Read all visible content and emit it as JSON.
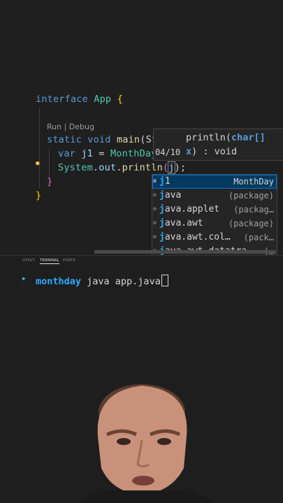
{
  "editor": {
    "code_lens": "Run | Debug",
    "lines": {
      "l1_kw": "interface",
      "l1_name": " App ",
      "l1_brace": "{",
      "l2_kw1": "static",
      "l2_kw2": "void",
      "l2_fn": "main",
      "l2_rest": "(St",
      "l3_kw": "var",
      "l3_var": "j1",
      "l3_eq": " = ",
      "l3_cls": "MonthDay",
      "l4_obj": "System",
      "l4_dot1": ".",
      "l4_out": "out",
      "l4_dot2": ".",
      "l4_fn": "println",
      "l4_open": "(",
      "l4_arg": "j",
      "l4_close": ");",
      "l5_brace": "}",
      "l6_brace": "}"
    }
  },
  "signature_hint": {
    "date_fragment": "04/10",
    "line1_prefix": "println(",
    "line1_param": "char[]",
    "line2_param": "x",
    "line2_suffix": ") : void"
  },
  "suggestions": [
    {
      "match": "j",
      "rest": "1",
      "detail": "MonthDay",
      "icon": "variable-icon",
      "selected": true
    },
    {
      "match": "j",
      "rest": "ava",
      "detail": "(package)",
      "icon": "package-icon",
      "selected": false
    },
    {
      "match": "j",
      "rest": "ava.applet",
      "detail": "(packag…",
      "icon": "package-icon",
      "selected": false
    },
    {
      "match": "j",
      "rest": "ava.awt",
      "detail": "(package)",
      "icon": "package-icon",
      "selected": false
    },
    {
      "match": "j",
      "rest": "ava.awt.col…",
      "detail": "(pack…",
      "icon": "package-icon",
      "selected": false
    },
    {
      "match": "j",
      "rest": "ava.awt.datatra…",
      "detail": "(…",
      "icon": "package-icon",
      "selected": false
    }
  ],
  "panel": {
    "tabs": [
      {
        "label": "UTPUT",
        "active": false
      },
      {
        "label": "TERMINAL",
        "active": true
      },
      {
        "label": "PORTS",
        "active": false
      }
    ]
  },
  "terminal": {
    "directory": "monthday",
    "command": " java app.java"
  },
  "colors": {
    "editor_bg": "#1f1f1f",
    "keyword": "#569cd6",
    "type": "#4ec9b0",
    "function": "#dcdcaa",
    "selection": "#04395e",
    "terminal_dir": "#2aaaff"
  }
}
